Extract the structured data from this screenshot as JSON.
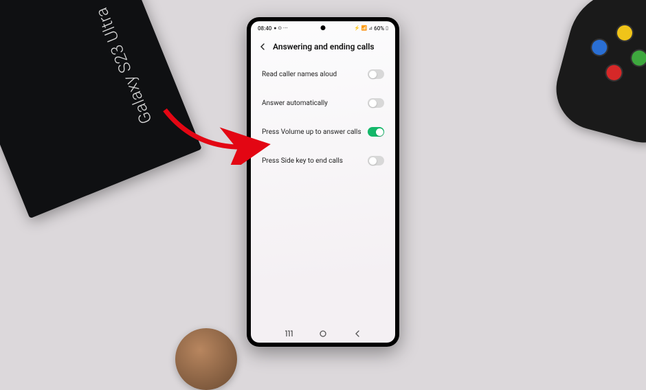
{
  "box_label": "Galaxy S23 Ultra",
  "status": {
    "time": "08:40",
    "left_icons": "● ⊙ ⋯",
    "right_icons": "⚡ 📶 ⊿",
    "battery": "60%",
    "battery_icon": "▯"
  },
  "header": {
    "title": "Answering and ending calls"
  },
  "settings": [
    {
      "label": "Read caller names aloud",
      "on": false
    },
    {
      "label": "Answer automatically",
      "on": false
    },
    {
      "label": "Press Volume up to answer calls",
      "on": true
    },
    {
      "label": "Press Side key to end calls",
      "on": false
    }
  ]
}
